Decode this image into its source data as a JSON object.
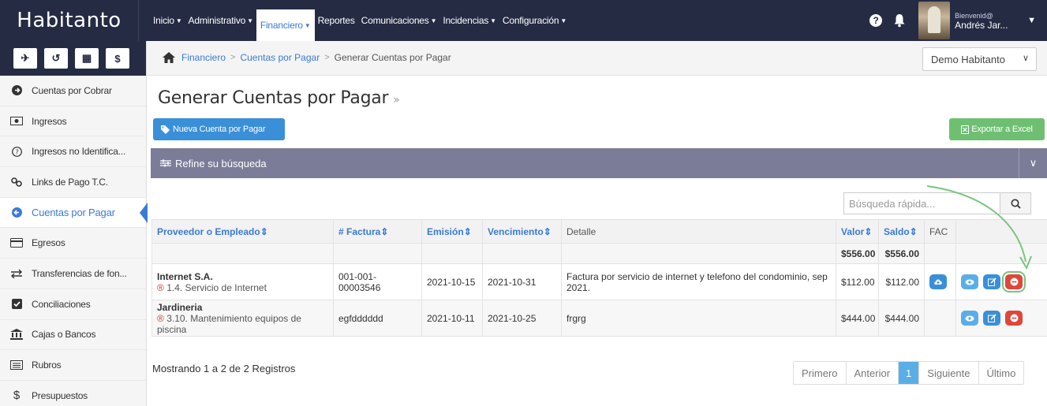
{
  "app": {
    "logo": "Habitanto"
  },
  "topnav": [
    {
      "label": "Inicio",
      "active": false
    },
    {
      "label": "Administrativo",
      "active": false
    },
    {
      "label": "Financiero",
      "active": true
    },
    {
      "label": "Reportes",
      "active": false
    },
    {
      "label": "Comunicaciones",
      "active": false
    },
    {
      "label": "Incidencias",
      "active": false
    },
    {
      "label": "Configuración",
      "active": false
    }
  ],
  "user": {
    "greeting": "Bienvenid@",
    "name": "Andrés Jar..."
  },
  "quick_actions": [
    "paper-plane-icon",
    "history-icon",
    "calculator-icon",
    "dollar-icon"
  ],
  "quick_glyphs": [
    "✈",
    "↺",
    "▦",
    "$"
  ],
  "sidebar": {
    "items": [
      {
        "label": "Cuentas por Cobrar",
        "icon": "circle-arrow-icon"
      },
      {
        "label": "Ingresos",
        "icon": "money-icon"
      },
      {
        "label": "Ingresos no Identifica...",
        "icon": "question-circle-icon"
      },
      {
        "label": "Links de Pago T.C.",
        "icon": "link-icon"
      },
      {
        "label": "Cuentas por Pagar",
        "icon": "circle-arrow-left-icon",
        "active": true
      },
      {
        "label": "Egresos",
        "icon": "credit-card-icon"
      },
      {
        "label": "Transferencias de fon...",
        "icon": "exchange-icon"
      },
      {
        "label": "Conciliaciones",
        "icon": "check-square-icon"
      },
      {
        "label": "Cajas o Bancos",
        "icon": "bank-icon"
      },
      {
        "label": "Rubros",
        "icon": "list-icon"
      },
      {
        "label": "Presupuestos",
        "icon": "dollar-sign-icon"
      }
    ]
  },
  "breadcrumb": {
    "level1": "Financiero",
    "level2": "Cuentas por Pagar",
    "current": "Generar Cuentas por Pagar"
  },
  "company_select": {
    "value": "Demo Habitanto"
  },
  "page": {
    "title": "Generar Cuentas por Pagar",
    "new_button": "Nueva Cuenta por Pagar",
    "export_button": "Exportar a Excel",
    "refine_label": "Refine su búsqueda",
    "search_placeholder": "Búsqueda rápida..."
  },
  "table": {
    "headers": {
      "proveedor": "Proveedor o Empleado",
      "factura": "# Factura",
      "emision": "Emisión",
      "vencimiento": "Vencimiento",
      "detalle": "Detalle",
      "valor": "Valor",
      "saldo": "Saldo",
      "fac": "FAC"
    },
    "totals": {
      "valor": "$556.00",
      "saldo": "$556.00"
    },
    "rows": [
      {
        "proveedor": "Internet S.A.",
        "rubro": "1.4. Servicio de Internet",
        "factura": "001-001-00003546",
        "emision": "2021-10-15",
        "vencimiento": "2021-10-31",
        "detalle": "Factura por servicio de internet y telefono del condominio, sep 2021.",
        "valor": "$112.00",
        "saldo": "$112.00"
      },
      {
        "proveedor": "Jardineria",
        "rubro": "3.10. Mantenimiento equipos de piscina",
        "factura": "egfdddddd",
        "emision": "2021-10-11",
        "vencimiento": "2021-10-25",
        "detalle": "frgrg",
        "valor": "$444.00",
        "saldo": "$444.00"
      }
    ]
  },
  "footer": {
    "records": "Mostrando 1 a 2 de 2 Registros",
    "pager": {
      "first": "Primero",
      "prev": "Anterior",
      "page": "1",
      "next": "Siguiente",
      "last": "Último"
    }
  },
  "colors": {
    "topbar": "#262b44",
    "accent": "#3a7bd5",
    "danger": "#e0463a",
    "success": "#6fbf73",
    "highlight": "#7bc47f"
  }
}
